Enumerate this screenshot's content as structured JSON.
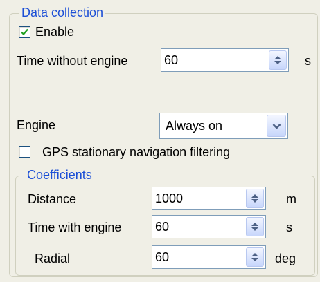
{
  "data_collection": {
    "title": "Data collection",
    "enable_label": "Enable",
    "enable_checked": true,
    "time_without_engine": {
      "label": "Time without engine",
      "value": "60",
      "unit": "s"
    },
    "engine": {
      "label": "Engine",
      "selected": "Always on"
    },
    "gps_filtering": {
      "label": "GPS stationary navigation filtering",
      "checked": false
    }
  },
  "coefficients": {
    "title": "Coefficients",
    "distance": {
      "label": "Distance",
      "value": "1000",
      "unit": "m"
    },
    "time_with_engine": {
      "label": "Time with engine",
      "value": "60",
      "unit": "s"
    },
    "radial": {
      "label": "Radial",
      "value": "60",
      "unit": "deg"
    }
  },
  "colors": {
    "legend": "#1c4fd6",
    "background": "#f0efe6",
    "check": "#21a121"
  },
  "icons": [
    "checkmark-icon",
    "spin-up-icon",
    "spin-down-icon",
    "chevron-down-icon"
  ]
}
